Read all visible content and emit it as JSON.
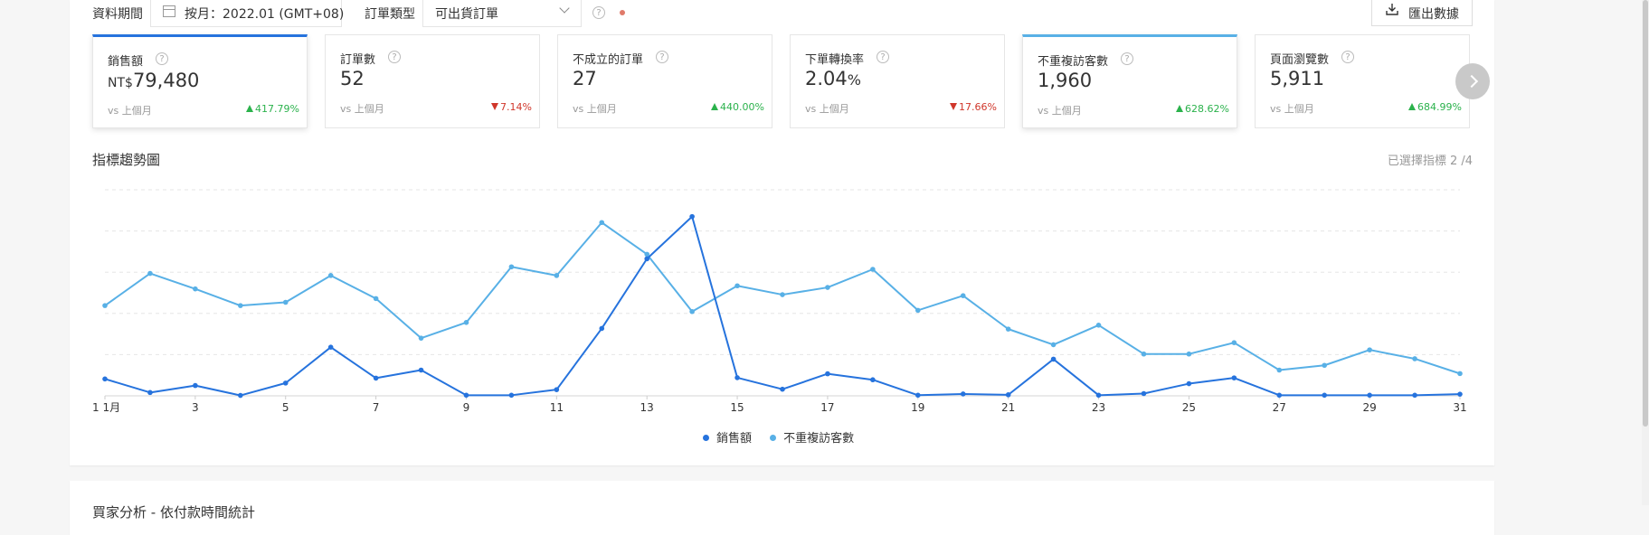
{
  "filters": {
    "period_label": "資料期間",
    "date_value": "按月：2022.01 (GMT+08)",
    "order_type_label": "訂單類型",
    "order_type_value": "可出貨訂單",
    "help_glyph": "?",
    "export_label": "匯出數據"
  },
  "metrics": [
    {
      "label": "銷售額",
      "currency": "NT$",
      "value": "79,480",
      "suffix": "",
      "compare": "vs 上個月",
      "change": "417.79%",
      "direction": "up",
      "state": "selected-dark"
    },
    {
      "label": "訂單數",
      "currency": "",
      "value": "52",
      "suffix": "",
      "compare": "vs 上個月",
      "change": "7.14%",
      "direction": "down",
      "state": "normal"
    },
    {
      "label": "不成立的訂單",
      "currency": "",
      "value": "27",
      "suffix": "",
      "compare": "vs 上個月",
      "change": "440.00%",
      "direction": "up",
      "state": "normal"
    },
    {
      "label": "下單轉換率",
      "currency": "",
      "value": "2.04",
      "suffix": "%",
      "compare": "vs 上個月",
      "change": "17.66%",
      "direction": "down",
      "state": "normal"
    },
    {
      "label": "不重複訪客數",
      "currency": "",
      "value": "1,960",
      "suffix": "",
      "compare": "vs 上個月",
      "change": "628.62%",
      "direction": "up",
      "state": "selected-light"
    },
    {
      "label": "頁面瀏覽數",
      "currency": "",
      "value": "5,911",
      "suffix": "",
      "compare": "vs 上個月",
      "change": "684.99%",
      "direction": "up",
      "state": "normal"
    }
  ],
  "trend": {
    "title": "指標趨勢圖",
    "selected_count": "已選擇指標 2 /4"
  },
  "bottom_card": {
    "title": "買家分析 - 依付款時間統計"
  },
  "colors": {
    "primary": "#2673dd",
    "secondary": "#58b0e6",
    "up": "#2bb24c",
    "down": "#d0362a"
  },
  "chart_data": {
    "type": "line",
    "x": [
      1,
      2,
      3,
      4,
      5,
      6,
      7,
      8,
      9,
      10,
      11,
      12,
      13,
      14,
      15,
      16,
      17,
      18,
      19,
      20,
      21,
      22,
      23,
      24,
      25,
      26,
      27,
      28,
      29,
      30,
      31
    ],
    "x_tick_labels": [
      "1 1月",
      "3",
      "5",
      "7",
      "9",
      "11",
      "13",
      "15",
      "17",
      "19",
      "21",
      "23",
      "25",
      "27",
      "29",
      "31"
    ],
    "x_tick_values": [
      1,
      3,
      5,
      7,
      9,
      11,
      13,
      15,
      17,
      19,
      21,
      23,
      25,
      27,
      29,
      31
    ],
    "grid": true,
    "legend_position": "bottom",
    "series": [
      {
        "name": "銷售額",
        "color": "#2673dd",
        "values": [
          8.2,
          1.6,
          5.0,
          0.2,
          6.2,
          23.6,
          8.6,
          12.5,
          0.3,
          0.3,
          3.0,
          32.7,
          66.5,
          87.0,
          8.8,
          3.2,
          10.7,
          7.8,
          0.3,
          0.9,
          0.5,
          17.8,
          0.3,
          1.1,
          5.9,
          8.7,
          0.3,
          0.3,
          0.3,
          0.3,
          0.8
        ]
      },
      {
        "name": "不重複訪客數",
        "color": "#58b0e6",
        "values": [
          43.8,
          59.4,
          51.9,
          43.8,
          45.4,
          58.4,
          47.2,
          28.0,
          35.6,
          62.6,
          58.4,
          84.1,
          68.7,
          40.9,
          53.4,
          49.1,
          52.6,
          61.4,
          41.5,
          48.6,
          32.4,
          24.8,
          34.3,
          20.3,
          20.3,
          25.8,
          12.5,
          14.8,
          22.3,
          18.0,
          10.8
        ]
      }
    ]
  }
}
